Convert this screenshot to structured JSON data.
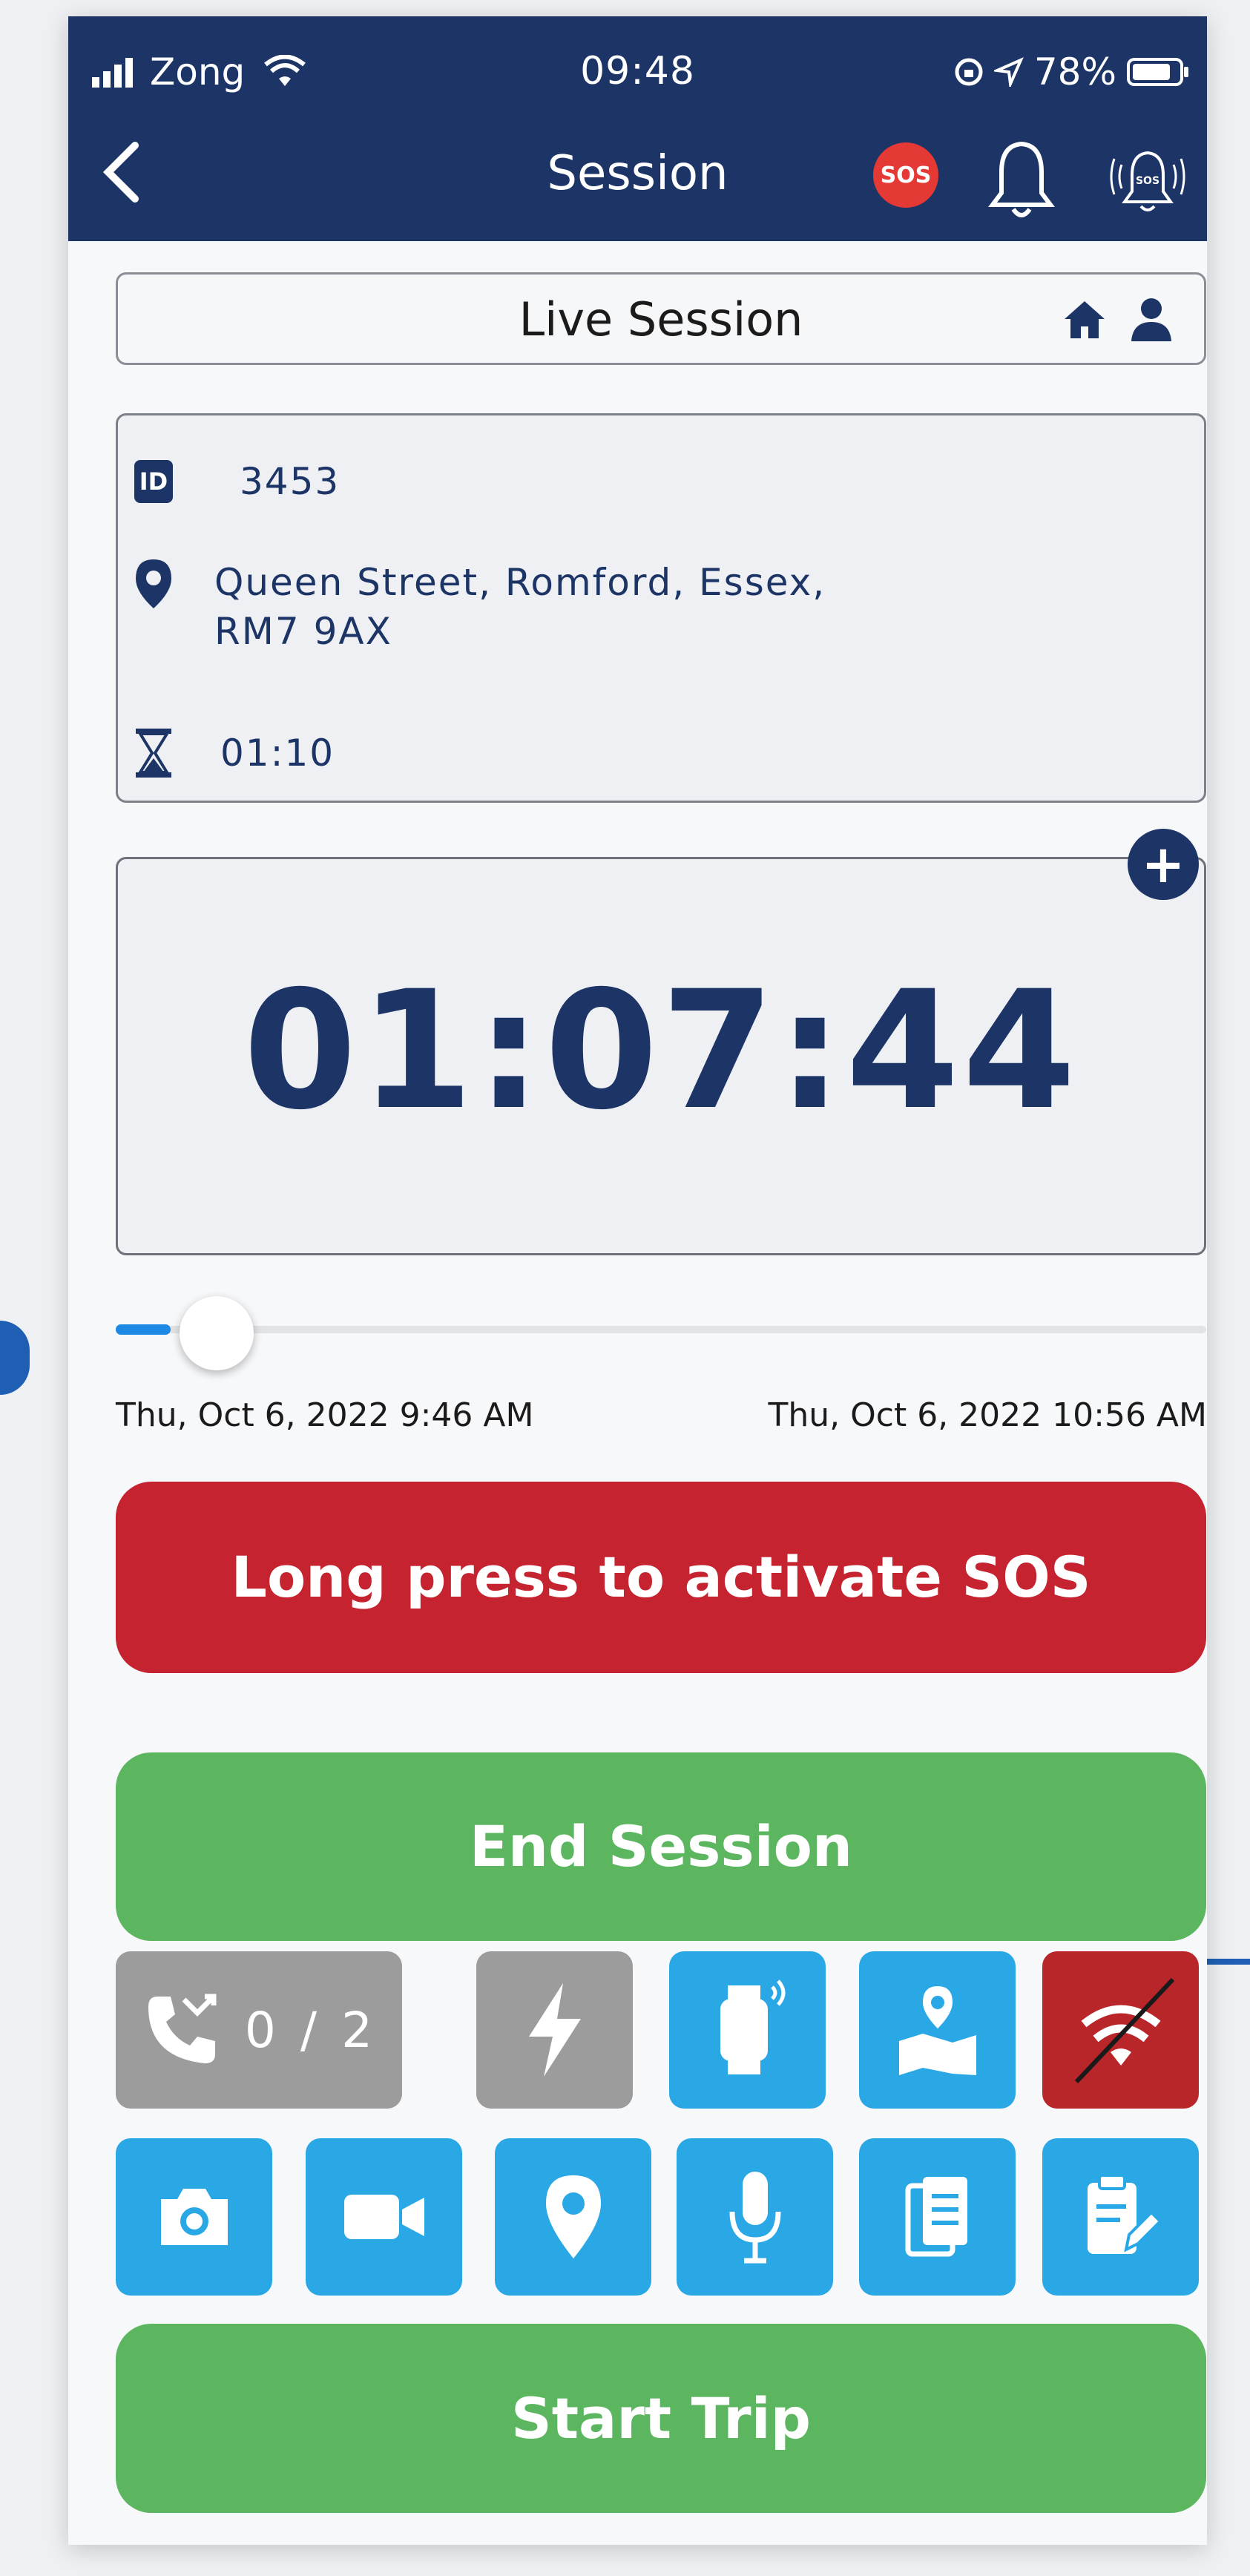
{
  "colors": {
    "header": "#1d3566",
    "accent_blue": "#2aa8e6",
    "sos_red": "#c4232f",
    "green": "#5cb660",
    "gray_tile": "#9c9c9c"
  },
  "status_bar": {
    "carrier": "Zong",
    "time": "09:48",
    "battery": "78%"
  },
  "header": {
    "title": "Session",
    "sos_badge": "SOS",
    "back_icon": "chevron-left-icon",
    "bell_icon": "bell-icon",
    "alarm_icon": "sos-alarm-bell-icon"
  },
  "session": {
    "label": "Live Session"
  },
  "info": {
    "id": "3453",
    "address_line1": "Queen Street, Romford, Essex,",
    "address_line2": "RM7 9AX",
    "duration": "01:10"
  },
  "timer": {
    "value": "01:07:44"
  },
  "slider": {
    "start": "Thu, Oct 6, 2022 9:46 AM",
    "end": "Thu, Oct 6, 2022 10:56 AM",
    "progress": 0.05
  },
  "buttons": {
    "sos": "Long press to activate SOS",
    "end_session": "End Session",
    "start_trip": "Start Trip"
  },
  "tiles": {
    "call_counter": "0 / 2"
  }
}
